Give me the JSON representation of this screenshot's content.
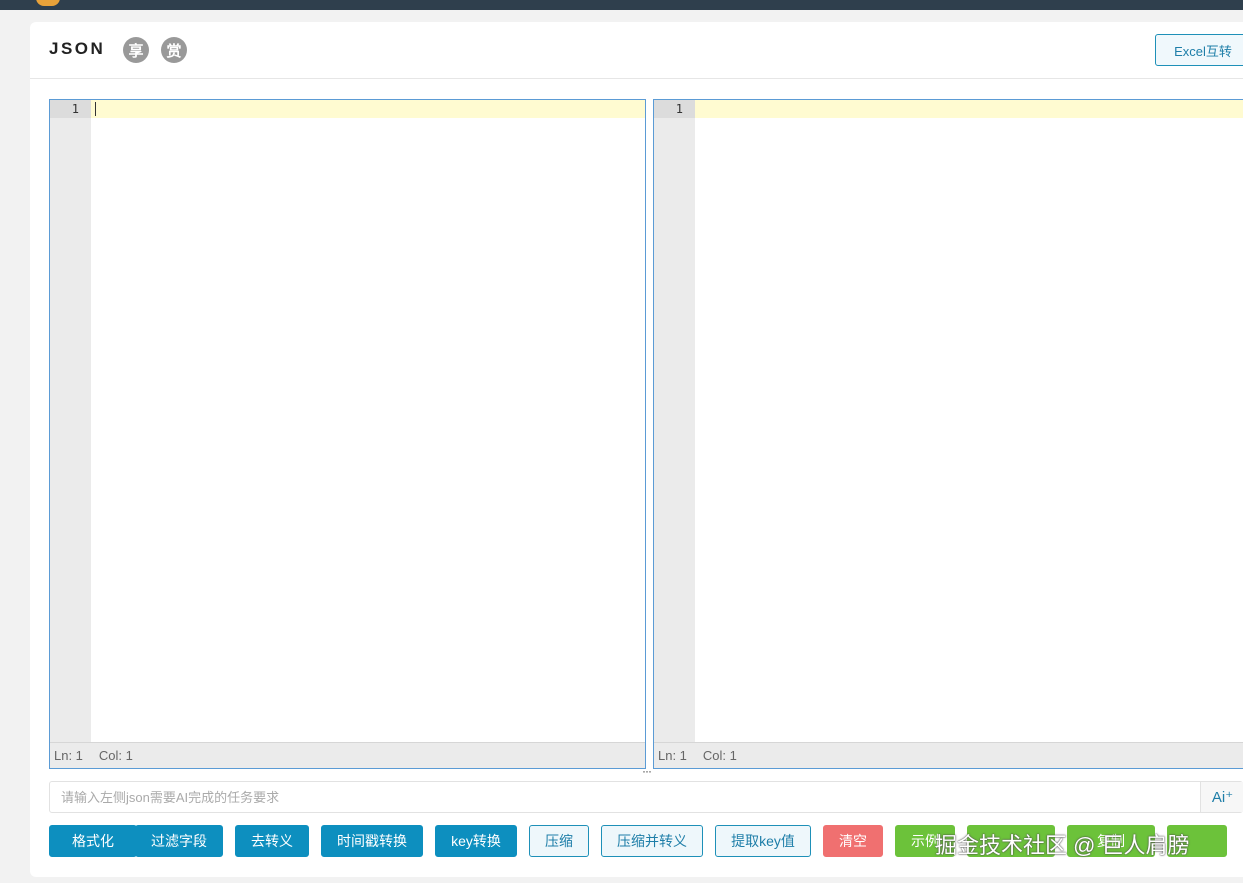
{
  "header": {
    "title": "JSON",
    "share_icon": "享",
    "reward_icon": "赏",
    "excel_button": "Excel互转"
  },
  "left_editor": {
    "line_number": "1",
    "status_ln": "Ln: 1",
    "status_col": "Col: 1"
  },
  "right_editor": {
    "line_number": "1",
    "status_ln": "Ln: 1",
    "status_col": "Col: 1"
  },
  "resize_handle": "···",
  "ai": {
    "placeholder": "请输入左侧json需要AI完成的任务要求",
    "value": "",
    "button_label": "Ai⁺"
  },
  "toolbar": {
    "format": "格式化",
    "filter_fields": "过滤字段",
    "unescape": "去转义",
    "timestamp": "时间戳转换",
    "key_convert": "key转换",
    "compress": "压缩",
    "compress_escape": "压缩并转义",
    "extract_key": "提取key值",
    "clear": "清空",
    "example": "示例",
    "green_2": "",
    "copy": "复制",
    "green_4": ""
  },
  "watermark": "掘金技术社区 @ 巨人肩膀",
  "colors": {
    "primary": "#0d8fbf",
    "danger": "#f07070",
    "success": "#6cc23a",
    "editor_border": "#5b9bd5",
    "active_line": "#fffbd1"
  }
}
